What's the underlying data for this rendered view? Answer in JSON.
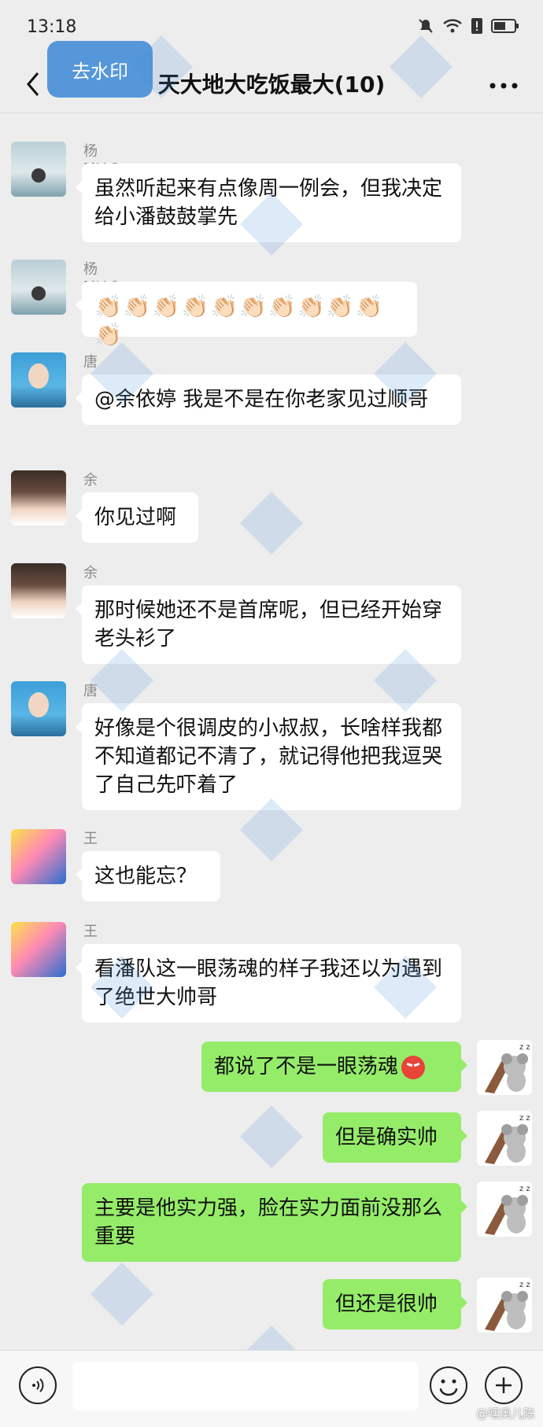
{
  "status": {
    "time": "13:18"
  },
  "header": {
    "title": "天大地大吃饭最大(10)",
    "watermark_button": "去水印"
  },
  "messages": [
    {
      "sender": "杨MIAO浚瑄",
      "text": "虽然听起来有点像周一例会，但我决定给小潘鼓鼓掌先"
    },
    {
      "sender": "杨MIAO浚瑄",
      "text": "👏🏻👏🏻👏🏻👏🏻👏🏻👏🏻👏🏻👏🏻👏🏻👏🏻👏🏻"
    },
    {
      "sender": "唐钱婷",
      "text": "@余依婷 我是不是在你老家见过顺哥"
    },
    {
      "sender": "余依婷",
      "text": "你见过啊"
    },
    {
      "sender": "余依婷",
      "text": "那时候她还不是首席呢，但已经开始穿老头衫了"
    },
    {
      "sender": "唐钱婷",
      "text": "好像是个很调皮的小叔叔，长啥样我都不知道都记不清了，就记得他把我逗哭了自己先吓着了"
    },
    {
      "sender": "王长浩",
      "text": "这也能忘？"
    },
    {
      "sender": "王长浩",
      "text": "看潘队这一眼荡魂的样子我还以为遇到了绝世大帅哥"
    }
  ],
  "my_messages": [
    {
      "text": "都说了不是一眼荡魂"
    },
    {
      "text": "但是确实帅"
    },
    {
      "text": "主要是他实力强，脸在实力面前没那么重要"
    },
    {
      "text": "但还是很帅"
    }
  ],
  "input": {
    "placeholder": ""
  },
  "credit": "@嘿奥儿陈",
  "colors": {
    "bubble_self": "#95ec69",
    "bubble_other": "#ffffff",
    "background": "#ededed"
  }
}
